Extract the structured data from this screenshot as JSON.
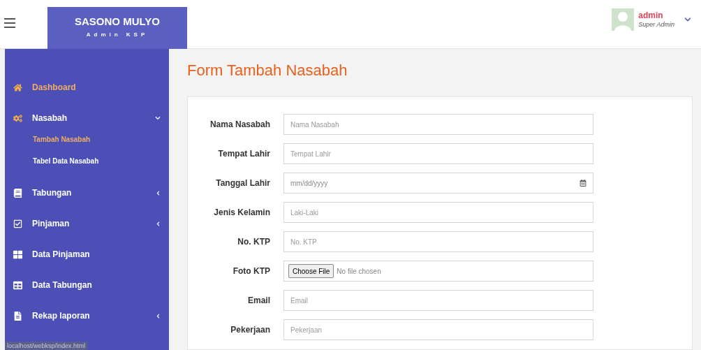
{
  "brand": {
    "title": "SASONO MULYO",
    "subtitle": "Admin KSP"
  },
  "user": {
    "name": "admin",
    "role": "Super Admin"
  },
  "sidebar": {
    "items": [
      {
        "label": "Dashboard",
        "kind": "link",
        "selected": true
      },
      {
        "label": "Nasabah",
        "kind": "menu",
        "expanded": true,
        "selected": false,
        "children": [
          {
            "label": "Tambah Nasabah",
            "selected": true
          },
          {
            "label": "Tabel Data Nasabah",
            "selected": false
          }
        ]
      },
      {
        "label": "Tabungan",
        "kind": "menu",
        "expanded": false,
        "selected": false
      },
      {
        "label": "Pinjaman",
        "kind": "menu",
        "expanded": false,
        "selected": false
      },
      {
        "label": "Data Pinjaman",
        "kind": "link",
        "selected": false
      },
      {
        "label": "Data Tabungan",
        "kind": "link",
        "selected": false
      },
      {
        "label": "Rekap laporan",
        "kind": "menu",
        "expanded": false,
        "selected": false
      }
    ]
  },
  "status_bar": "localhost/webksp/index.html",
  "page_title": "Form Tambah Nasabah",
  "form": {
    "fields": [
      {
        "label": "Nama Nasabah",
        "kind": "text",
        "placeholder": "Nama Nasabah"
      },
      {
        "label": "Tempat Lahir",
        "kind": "text",
        "placeholder": "Tempat Lahir"
      },
      {
        "label": "Tanggal Lahir",
        "kind": "date",
        "placeholder": "mm/dd/yyyy"
      },
      {
        "label": "Jenis Kelamin",
        "kind": "text",
        "placeholder": "Laki-Laki"
      },
      {
        "label": "No. KTP",
        "kind": "text",
        "placeholder": "No. KTP"
      },
      {
        "label": "Foto KTP",
        "kind": "file",
        "button": "Choose File",
        "value": "No file chosen"
      },
      {
        "label": "Email",
        "kind": "text",
        "placeholder": "Email"
      },
      {
        "label": "Pekerjaan",
        "kind": "text",
        "placeholder": "Pekerjaan"
      }
    ]
  }
}
